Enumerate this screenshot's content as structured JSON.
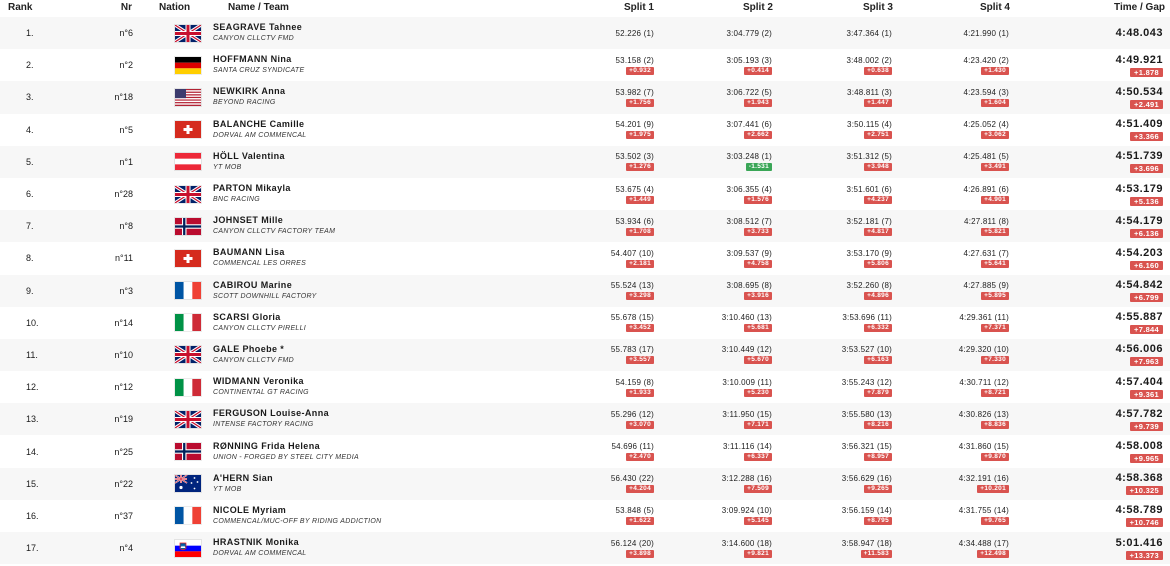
{
  "headers": {
    "rank": "Rank",
    "nr": "Nr",
    "nation": "Nation",
    "name": "Name / Team",
    "split1": "Split 1",
    "split2": "Split 2",
    "split3": "Split 3",
    "split4": "Split 4",
    "time": "Time / Gap"
  },
  "gap_colors": {
    "behind": "#d9534f",
    "ahead": "#3aa657"
  },
  "rows": [
    {
      "rank": "1.",
      "nr": "n°6",
      "nation": "gbr-flag-icon",
      "name": "SEAGRAVE Tahnee",
      "team": "CANYON CLLCTV FMD",
      "s1": "52.226 (1)",
      "g1": "",
      "s2": "3:04.779 (2)",
      "g2": "",
      "s3": "3:47.364 (1)",
      "g3": "",
      "s4": "4:21.990 (1)",
      "g4": "",
      "time": "4:48.043",
      "gap": ""
    },
    {
      "rank": "2.",
      "nr": "n°2",
      "nation": "ger-flag-icon",
      "name": "HOFFMANN Nina",
      "team": "SANTA CRUZ SYNDICATE",
      "s1": "53.158 (2)",
      "g1": "+0.932",
      "s2": "3:05.193 (3)",
      "g2": "+0.414",
      "s3": "3:48.002 (2)",
      "g3": "+0.638",
      "s4": "4:23.420 (2)",
      "g4": "+1.430",
      "time": "4:49.921",
      "gap": "+1.878"
    },
    {
      "rank": "3.",
      "nr": "n°18",
      "nation": "usa-flag-icon",
      "name": "NEWKIRK Anna",
      "team": "BEYOND RACING",
      "s1": "53.982 (7)",
      "g1": "+1.756",
      "s2": "3:06.722 (5)",
      "g2": "+1.943",
      "s3": "3:48.811 (3)",
      "g3": "+1.447",
      "s4": "4:23.594 (3)",
      "g4": "+1.604",
      "time": "4:50.534",
      "gap": "+2.491"
    },
    {
      "rank": "4.",
      "nr": "n°5",
      "nation": "sui-flag-icon",
      "name": "BALANCHE Camille",
      "team": "DORVAL AM COMMENCAL",
      "s1": "54.201 (9)",
      "g1": "+1.975",
      "s2": "3:07.441 (6)",
      "g2": "+2.662",
      "s3": "3:50.115 (4)",
      "g3": "+2.751",
      "s4": "4:25.052 (4)",
      "g4": "+3.062",
      "time": "4:51.409",
      "gap": "+3.366"
    },
    {
      "rank": "5.",
      "nr": "n°1",
      "nation": "aut-flag-icon",
      "name": "HÖLL Valentina",
      "team": "YT MOB",
      "s1": "53.502 (3)",
      "g1": "+1.276",
      "s2": "3:03.248 (1)",
      "g2": "-1.531",
      "s3": "3:51.312 (5)",
      "g3": "+3.948",
      "s4": "4:25.481 (5)",
      "g4": "+3.491",
      "time": "4:51.739",
      "gap": "+3.696"
    },
    {
      "rank": "6.",
      "nr": "n°28",
      "nation": "gbr-flag-icon",
      "name": "PARTON Mikayla",
      "team": "BNC RACING",
      "s1": "53.675 (4)",
      "g1": "+1.449",
      "s2": "3:06.355 (4)",
      "g2": "+1.576",
      "s3": "3:51.601 (6)",
      "g3": "+4.237",
      "s4": "4:26.891 (6)",
      "g4": "+4.901",
      "time": "4:53.179",
      "gap": "+5.136"
    },
    {
      "rank": "7.",
      "nr": "n°8",
      "nation": "nor-flag-icon",
      "name": "JOHNSET Mille",
      "team": "CANYON CLLCTV FACTORY TEAM",
      "s1": "53.934 (6)",
      "g1": "+1.708",
      "s2": "3:08.512 (7)",
      "g2": "+3.733",
      "s3": "3:52.181 (7)",
      "g3": "+4.817",
      "s4": "4:27.811 (8)",
      "g4": "+5.821",
      "time": "4:54.179",
      "gap": "+6.136"
    },
    {
      "rank": "8.",
      "nr": "n°11",
      "nation": "sui-flag-icon",
      "name": "BAUMANN Lisa",
      "team": "COMMENCAL LES ORRES",
      "s1": "54.407 (10)",
      "g1": "+2.181",
      "s2": "3:09.537 (9)",
      "g2": "+4.758",
      "s3": "3:53.170 (9)",
      "g3": "+5.806",
      "s4": "4:27.631 (7)",
      "g4": "+5.641",
      "time": "4:54.203",
      "gap": "+6.160"
    },
    {
      "rank": "9.",
      "nr": "n°3",
      "nation": "fra-flag-icon",
      "name": "CABIROU Marine",
      "team": "SCOTT DOWNHILL FACTORY",
      "s1": "55.524 (13)",
      "g1": "+3.298",
      "s2": "3:08.695 (8)",
      "g2": "+3.916",
      "s3": "3:52.260 (8)",
      "g3": "+4.896",
      "s4": "4:27.885 (9)",
      "g4": "+5.895",
      "time": "4:54.842",
      "gap": "+6.799"
    },
    {
      "rank": "10.",
      "nr": "n°14",
      "nation": "ita-flag-icon",
      "name": "SCARSI Gloria",
      "team": "CANYON CLLCTV PIRELLI",
      "s1": "55.678 (15)",
      "g1": "+3.452",
      "s2": "3:10.460 (13)",
      "g2": "+5.681",
      "s3": "3:53.696 (11)",
      "g3": "+6.332",
      "s4": "4:29.361 (11)",
      "g4": "+7.371",
      "time": "4:55.887",
      "gap": "+7.844"
    },
    {
      "rank": "11.",
      "nr": "n°10",
      "nation": "gbr-flag-icon",
      "name": "GALE Phoebe *",
      "team": "CANYON CLLCTV FMD",
      "s1": "55.783 (17)",
      "g1": "+3.557",
      "s2": "3:10.449 (12)",
      "g2": "+5.670",
      "s3": "3:53.527 (10)",
      "g3": "+6.163",
      "s4": "4:29.320 (10)",
      "g4": "+7.330",
      "time": "4:56.006",
      "gap": "+7.963"
    },
    {
      "rank": "12.",
      "nr": "n°12",
      "nation": "ita-flag-icon",
      "name": "WIDMANN Veronika",
      "team": "CONTINENTAL GT RACING",
      "s1": "54.159 (8)",
      "g1": "+1.933",
      "s2": "3:10.009 (11)",
      "g2": "+5.230",
      "s3": "3:55.243 (12)",
      "g3": "+7.879",
      "s4": "4:30.711 (12)",
      "g4": "+8.721",
      "time": "4:57.404",
      "gap": "+9.361"
    },
    {
      "rank": "13.",
      "nr": "n°19",
      "nation": "gbr-flag-icon",
      "name": "FERGUSON Louise-Anna",
      "team": "INTENSE FACTORY RACING",
      "s1": "55.296 (12)",
      "g1": "+3.070",
      "s2": "3:11.950 (15)",
      "g2": "+7.171",
      "s3": "3:55.580 (13)",
      "g3": "+8.216",
      "s4": "4:30.826 (13)",
      "g4": "+8.836",
      "time": "4:57.782",
      "gap": "+9.739"
    },
    {
      "rank": "14.",
      "nr": "n°25",
      "nation": "nor-flag-icon",
      "name": "RØNNING Frida Helena",
      "team": "UNION - FORGED BY STEEL CITY MEDIA",
      "s1": "54.696 (11)",
      "g1": "+2.470",
      "s2": "3:11.116 (14)",
      "g2": "+6.337",
      "s3": "3:56.321 (15)",
      "g3": "+8.957",
      "s4": "4:31.860 (15)",
      "g4": "+9.870",
      "time": "4:58.008",
      "gap": "+9.965"
    },
    {
      "rank": "15.",
      "nr": "n°22",
      "nation": "aus-flag-icon",
      "name": "A'HERN Sian",
      "team": "YT MOB",
      "s1": "56.430 (22)",
      "g1": "+4.204",
      "s2": "3:12.288 (16)",
      "g2": "+7.509",
      "s3": "3:56.629 (16)",
      "g3": "+9.265",
      "s4": "4:32.191 (16)",
      "g4": "+10.201",
      "time": "4:58.368",
      "gap": "+10.325"
    },
    {
      "rank": "16.",
      "nr": "n°37",
      "nation": "fra-flag-icon",
      "name": "NICOLE Myriam",
      "team": "COMMENCAL/MUC-OFF BY RIDING ADDICTION",
      "s1": "53.848 (5)",
      "g1": "+1.622",
      "s2": "3:09.924 (10)",
      "g2": "+5.145",
      "s3": "3:56.159 (14)",
      "g3": "+8.795",
      "s4": "4:31.755 (14)",
      "g4": "+9.765",
      "time": "4:58.789",
      "gap": "+10.746"
    },
    {
      "rank": "17.",
      "nr": "n°4",
      "nation": "slo-flag-icon",
      "name": "HRASTNIK Monika",
      "team": "DORVAL AM COMMENCAL",
      "s1": "56.124 (20)",
      "g1": "+3.898",
      "s2": "3:14.600 (18)",
      "g2": "+9.821",
      "s3": "3:58.947 (18)",
      "g3": "+11.583",
      "s4": "4:34.488 (17)",
      "g4": "+12.498",
      "time": "5:01.416",
      "gap": "+13.373"
    }
  ]
}
